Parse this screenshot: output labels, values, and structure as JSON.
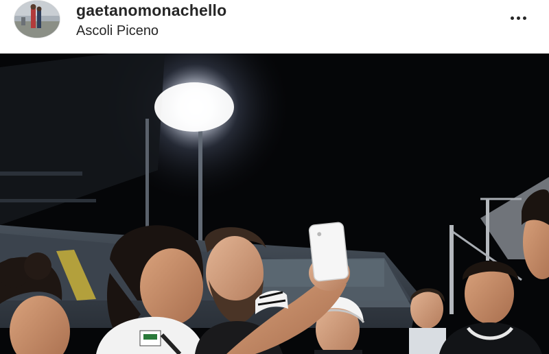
{
  "post": {
    "username": "gaetanomonachello",
    "location": "Ascoli Piceno",
    "avatar_icon": "profile-photo",
    "more_icon": "more-horizontal-icon",
    "photo_icon": "stadium-selfie-photo"
  },
  "colors": {
    "text": "#262626",
    "background": "#ffffff",
    "night_sky": "#050608"
  }
}
